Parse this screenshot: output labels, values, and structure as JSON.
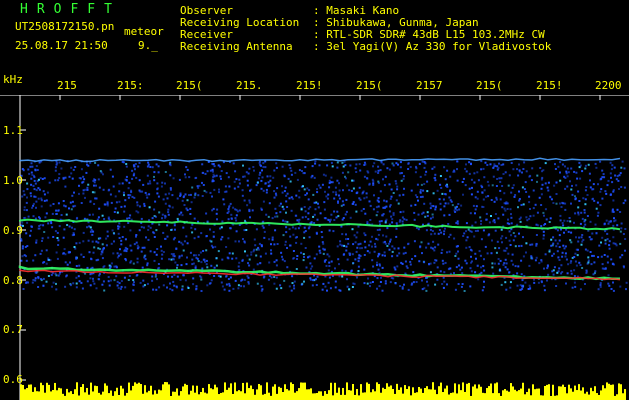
{
  "app": {
    "title": "HROFFT"
  },
  "file": {
    "name": "UT2508172150.pn",
    "mode": "meteor"
  },
  "datetime": {
    "value": "25.08.17 21:50",
    "extra": "9._"
  },
  "info": [
    {
      "label": "Observer",
      "value": ": Masaki Kano"
    },
    {
      "label": "Receiving Location",
      "value": ": Shibukawa, Gunma, Japan"
    },
    {
      "label": "Receiver",
      "value": ": RTL-SDR SDR# 43dB L15 103.2MHz CW"
    },
    {
      "label": "Receiving Antenna",
      "value": ": 3el Yagi(V) Az 330 for Vladivostok"
    }
  ],
  "axis": {
    "y_unit": "kHz",
    "x_ticks": [
      "215",
      "215:",
      "215(",
      "215.",
      "215!",
      "215(",
      "2157",
      "215(",
      "215!",
      "2200"
    ],
    "y_ticks": [
      "1.1",
      "1.0",
      "0.9",
      "0.8",
      "0.7",
      "0.6"
    ]
  },
  "colors": {
    "text": "#ffff00",
    "title": "#33ff33",
    "background": "#000000",
    "signal_strong": "#ff3030",
    "signal_mid": "#33ff66",
    "noise": "#1e4fff",
    "meteor_echo": "#ffff00"
  }
}
